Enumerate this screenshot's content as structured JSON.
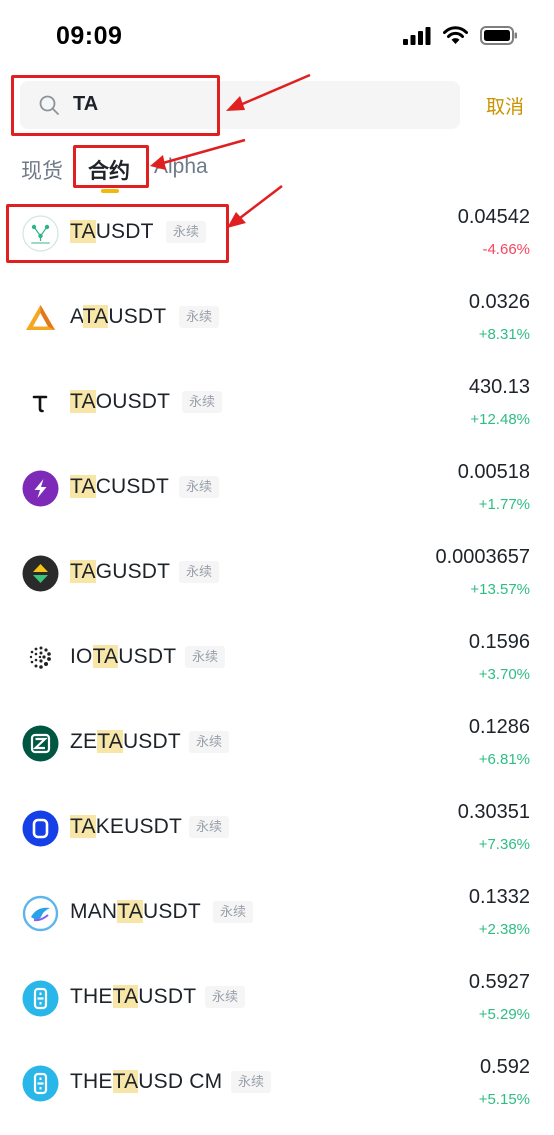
{
  "status_bar": {
    "time": "09:09"
  },
  "search": {
    "query": "TA",
    "cancel_label": "取消"
  },
  "tabs": [
    {
      "label": "现货",
      "active": false
    },
    {
      "label": "合约",
      "active": true
    },
    {
      "label": "Alpha",
      "active": false
    }
  ],
  "colors": {
    "accent": "#f0b90b",
    "cancel": "#c99400",
    "up": "#2ebd85",
    "down": "#f6465d",
    "highlight": "#f8e6a8",
    "annotation": "#e02020"
  },
  "markets": [
    {
      "pre": "",
      "match": "TA",
      "post": "USDT",
      "badge": "永续",
      "price": "0.04542",
      "change": "-4.66%",
      "direction": "down",
      "icon": "tao-network-icon"
    },
    {
      "pre": "A",
      "match": "TA",
      "post": "USDT",
      "badge": "永续",
      "price": "0.0326",
      "change": "+8.31%",
      "direction": "up",
      "icon": "automata-icon"
    },
    {
      "pre": "",
      "match": "TA",
      "post": "OUSDT",
      "badge": "永续",
      "price": "430.13",
      "change": "+12.48%",
      "direction": "up",
      "icon": "bittensor-icon"
    },
    {
      "pre": "",
      "match": "TA",
      "post": "CUSDT",
      "badge": "永续",
      "price": "0.00518",
      "change": "+1.77%",
      "direction": "up",
      "icon": "tac-icon"
    },
    {
      "pre": "",
      "match": "TA",
      "post": "GUSDT",
      "badge": "永续",
      "price": "0.0003657",
      "change": "+13.57%",
      "direction": "up",
      "icon": "tag-icon"
    },
    {
      "pre": "IO",
      "match": "TA",
      "post": "USDT",
      "badge": "永续",
      "price": "0.1596",
      "change": "+3.70%",
      "direction": "up",
      "icon": "iota-icon"
    },
    {
      "pre": "ZE",
      "match": "TA",
      "post": "USDT",
      "badge": "永续",
      "price": "0.1286",
      "change": "+6.81%",
      "direction": "up",
      "icon": "zeta-icon"
    },
    {
      "pre": "",
      "match": "TA",
      "post": "KEUSDT",
      "badge": "永续",
      "price": "0.30351",
      "change": "+7.36%",
      "direction": "up",
      "icon": "take-icon"
    },
    {
      "pre": "MAN",
      "match": "TA",
      "post": "USDT",
      "badge": "永续",
      "price": "0.1332",
      "change": "+2.38%",
      "direction": "up",
      "icon": "manta-icon"
    },
    {
      "pre": "THE",
      "match": "TA",
      "post": "USDT",
      "badge": "永续",
      "price": "0.5927",
      "change": "+5.29%",
      "direction": "up",
      "icon": "theta-icon"
    },
    {
      "pre": "THE",
      "match": "TA",
      "post": "USD CM",
      "badge": "永续",
      "price": "0.592",
      "change": "+5.15%",
      "direction": "up",
      "icon": "theta-icon"
    }
  ]
}
